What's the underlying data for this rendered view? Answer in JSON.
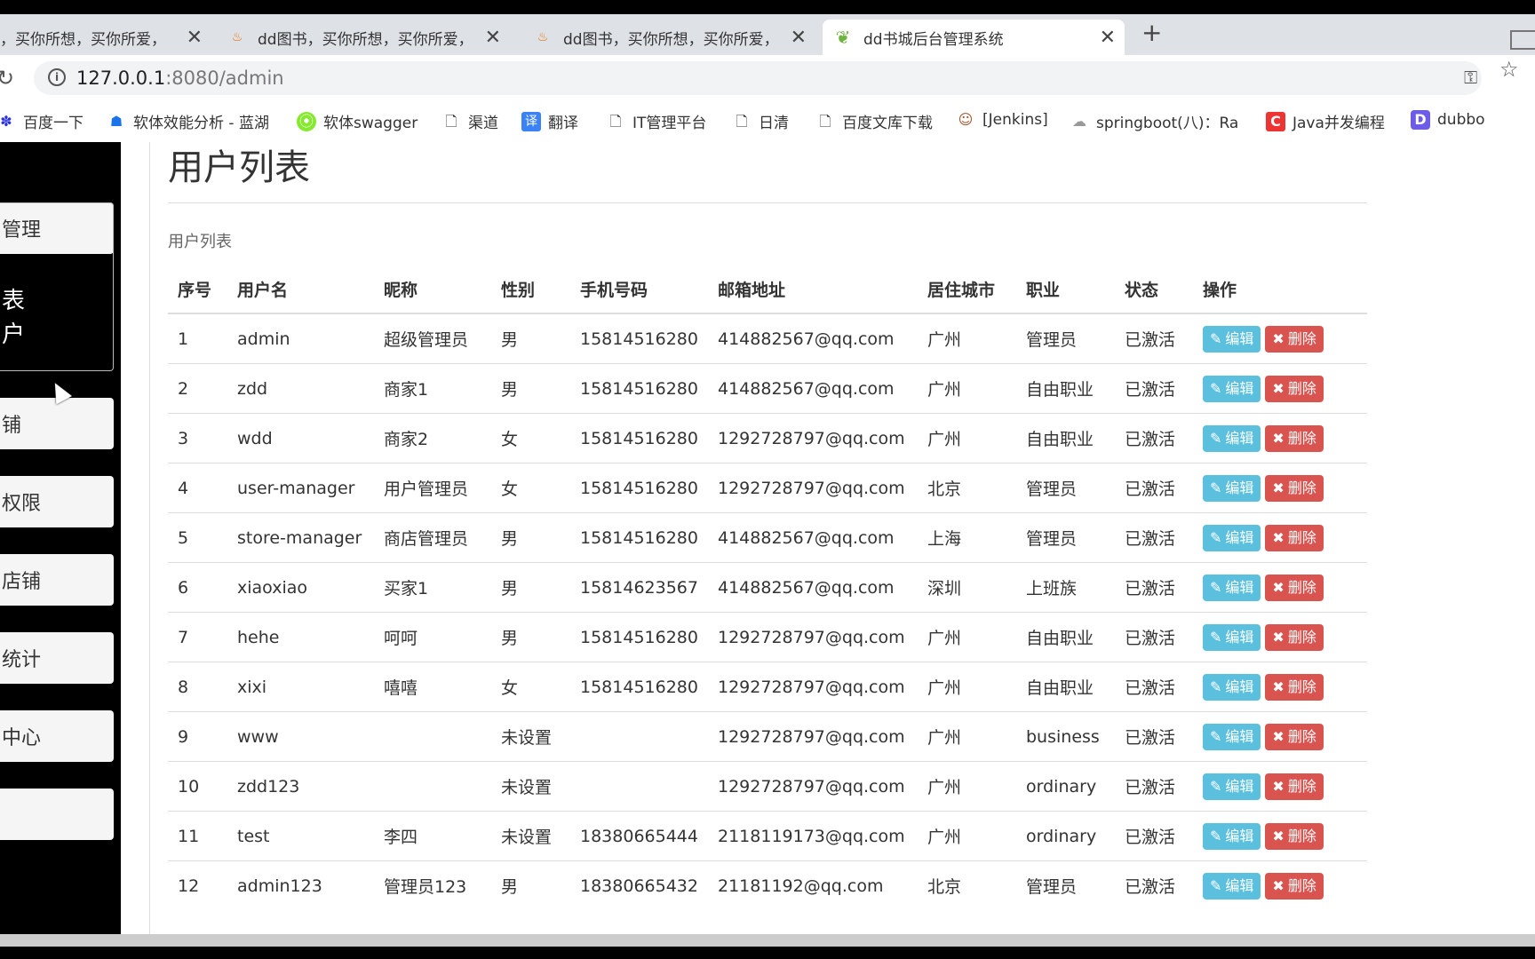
{
  "tabs": [
    {
      "title": "，买你所想，买你所爱，",
      "icon": "java-icon"
    },
    {
      "title": "dd图书，买你所想，买你所爱，",
      "icon": "java-icon"
    },
    {
      "title": "dd图书，买你所想，买你所爱，",
      "icon": "java-icon"
    },
    {
      "title": "dd书城后台管理系统",
      "icon": "leaf-icon"
    }
  ],
  "address": {
    "host": "127.0.0.1",
    "rest": ":8080/admin"
  },
  "bookmarks": [
    {
      "label": "百度一下"
    },
    {
      "label": "软体效能分析 - 蓝湖"
    },
    {
      "label": "软体swagger"
    },
    {
      "label": "渠道"
    },
    {
      "label": "翻译"
    },
    {
      "label": "IT管理平台"
    },
    {
      "label": "日清"
    },
    {
      "label": "百度文库下载"
    },
    {
      "label": "[Jenkins]"
    },
    {
      "label": "springboot(八)：Ra"
    },
    {
      "label": "Java并发编程"
    },
    {
      "label": "dubbo"
    }
  ],
  "sidebar": {
    "items": [
      {
        "label": "管理"
      },
      {
        "label": "铺"
      },
      {
        "label": "权限"
      },
      {
        "label": "店铺"
      },
      {
        "label": "统计"
      },
      {
        "label": "中心"
      },
      {
        "label": ""
      }
    ],
    "sub": [
      "表",
      "户"
    ]
  },
  "page": {
    "title": "用户列表",
    "subtitle": "用户列表"
  },
  "table": {
    "headers": [
      "序号",
      "用户名",
      "昵称",
      "性别",
      "手机号码",
      "邮箱地址",
      "居住城市",
      "职业",
      "状态",
      "操作"
    ],
    "edit_label": "编辑",
    "delete_label": "删除",
    "rows": [
      [
        "1",
        "admin",
        "超级管理员",
        "男",
        "15814516280",
        "414882567@qq.com",
        "广州",
        "管理员",
        "已激活"
      ],
      [
        "2",
        "zdd",
        "商家1",
        "男",
        "15814516280",
        "414882567@qq.com",
        "广州",
        "自由职业",
        "已激活"
      ],
      [
        "3",
        "wdd",
        "商家2",
        "女",
        "15814516280",
        "1292728797@qq.com",
        "广州",
        "自由职业",
        "已激活"
      ],
      [
        "4",
        "user-manager",
        "用户管理员",
        "女",
        "15814516280",
        "1292728797@qq.com",
        "北京",
        "管理员",
        "已激活"
      ],
      [
        "5",
        "store-manager",
        "商店管理员",
        "男",
        "15814516280",
        "414882567@qq.com",
        "上海",
        "管理员",
        "已激活"
      ],
      [
        "6",
        "xiaoxiao",
        "买家1",
        "男",
        "15814623567",
        "414882567@qq.com",
        "深圳",
        "上班族",
        "已激活"
      ],
      [
        "7",
        "hehe",
        "呵呵",
        "男",
        "15814516280",
        "1292728797@qq.com",
        "广州",
        "自由职业",
        "已激活"
      ],
      [
        "8",
        "xixi",
        "嘻嘻",
        "女",
        "15814516280",
        "1292728797@qq.com",
        "广州",
        "自由职业",
        "已激活"
      ],
      [
        "9",
        "www",
        "",
        "未设置",
        "",
        "1292728797@qq.com",
        "广州",
        "business",
        "已激活"
      ],
      [
        "10",
        "zdd123",
        "",
        "未设置",
        "",
        "1292728797@qq.com",
        "广州",
        "ordinary",
        "已激活"
      ],
      [
        "11",
        "test",
        "李四",
        "未设置",
        "18380665444",
        "2118119173@qq.com",
        "广州",
        "ordinary",
        "已激活"
      ],
      [
        "12",
        "admin123",
        "管理员123",
        "男",
        "18380665432",
        "21181192@qq.com",
        "北京",
        "管理员",
        "已激活"
      ]
    ]
  },
  "colors": {
    "edit": "#5bc0de",
    "delete": "#d9534f"
  }
}
